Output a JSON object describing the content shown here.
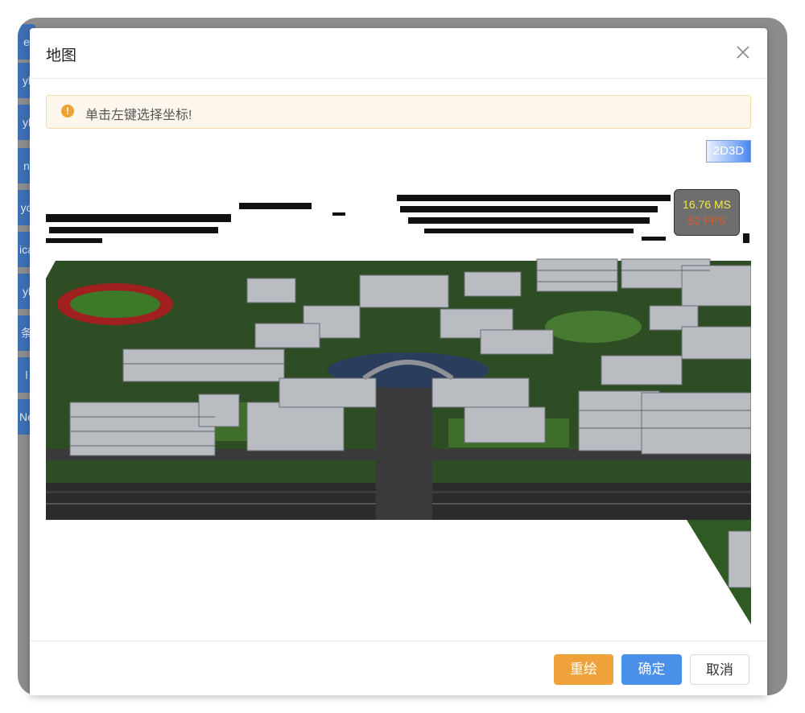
{
  "background_tabs": [
    "e",
    "yl",
    "yl",
    "n",
    "yo",
    "ica",
    "yl",
    "条 p",
    "l",
    "Ne"
  ],
  "modal": {
    "title": "地图",
    "alert_text": "单击左键选择坐标!",
    "alert_icon": "!",
    "toggle_label": "2D3D",
    "stats": {
      "ms": "16.76 MS",
      "fps": "52 FPS"
    }
  },
  "footer": {
    "redraw_label": "重绘",
    "ok_label": "确定",
    "cancel_label": "取消"
  },
  "colors": {
    "redraw": "#f0a23a",
    "ok": "#4a8fe8",
    "alert_bg": "#fdf6ec",
    "map_ground": "#2f5a24"
  }
}
